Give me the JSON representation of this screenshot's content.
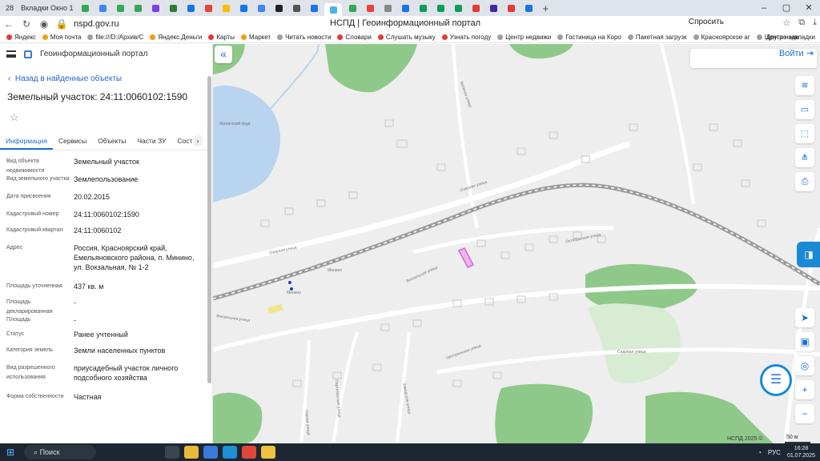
{
  "browser": {
    "tab_count": "28",
    "first_tab": "Вкладки Окно 1",
    "url": "nspd.gov.ru",
    "page_title": "НСПД | Геоинформационный портал",
    "ask_button": "Спросить",
    "bookmarks": [
      "Яндекс",
      "Моя почта",
      "file:///D:/Архив/С",
      "Яндекс.Деньги",
      "Карты",
      "Маркет",
      "Читать новости",
      "Словари",
      "Слушать музыку",
      "Узнать погоду",
      "Центр недвижи",
      "Гостиница на Коро",
      "Пакетная загрузк",
      "Красноярское аг",
      "Центр недв"
    ],
    "other_bookmarks": "Другие закладки",
    "pinned_tab_colors": [
      "#34a853",
      "#4285f4",
      "#34a853",
      "#34a853",
      "#7b3fe4",
      "#2e7d32",
      "#1a73e8",
      "#ea4335",
      "#fbbc05",
      "#1a73e8",
      "#4285f4",
      "#222",
      "#555",
      "#1a73e8",
      "#fff",
      "#34a853",
      "#ea4335",
      "#888",
      "#1a73e8",
      "#0f9d58",
      "#0f9d58",
      "#0f9d58",
      "#e53935",
      "#4527a0",
      "#e53935",
      "#1a73e8"
    ]
  },
  "portal": {
    "name": "Геоинформационный портал",
    "back_link": "Назад в найденные объекты",
    "object_title": "Земельный участок: 24:11:0060102:1590",
    "tabs": [
      "Информация",
      "Сервисы",
      "Объекты",
      "Части ЗУ",
      "Состав"
    ],
    "fields": [
      {
        "key": "Вид объекта недвижимости",
        "value": "Земельный участок"
      },
      {
        "key": "Вид земельного участка",
        "value": "Землепользование"
      },
      {
        "key": "Дата присвоения",
        "value": "20.02.2015"
      },
      {
        "key": "Кадастровый номер",
        "value": "24:11:0060102:1590"
      },
      {
        "key": "Кадастровый квартал",
        "value": "24:11:0060102"
      },
      {
        "key": "Адрес",
        "value": "Россия, Красноярский край, Емельяновского района, п. Минино, ул. Вокзальная, № 1-2"
      },
      {
        "key": "Площадь уточненная",
        "value": "437 кв. м"
      },
      {
        "key": "Площадь декларированная",
        "value": "-"
      },
      {
        "key": "Площадь",
        "value": "-"
      },
      {
        "key": "Статус",
        "value": "Ранее учтенный"
      },
      {
        "key": "Категория земель",
        "value": "Земли населенных пунктов"
      },
      {
        "key": "Вид разрешенного использования",
        "value": "приусадебный участок личного подсобного хозяйства"
      },
      {
        "key": "Форма собственности",
        "value": "Частная"
      }
    ]
  },
  "map": {
    "login": "Войти",
    "credits": "НСПД 2025 ©",
    "scale": "50 м",
    "labels": [
      "Озерная улица",
      "Вокзальная улица",
      "Октябрьская улица",
      "Садовая улица",
      "Центральная улица",
      "Зеленая улица",
      "Заводская улица",
      "Партизанская улица",
      "Горная улица",
      "Вокзальная улица",
      "Озерная улица",
      "Минино",
      "Минино",
      "Жилинский пруд"
    ],
    "colors": {
      "water": "#b9d4ee",
      "forest": "#8fc98a",
      "road": "#ffffff",
      "rail": "#9a9a9a",
      "highlight": "#d36bd8"
    }
  },
  "taskbar": {
    "search": "Поиск",
    "lang": "РУС",
    "time": "16:28",
    "date": "01.07.2025"
  }
}
